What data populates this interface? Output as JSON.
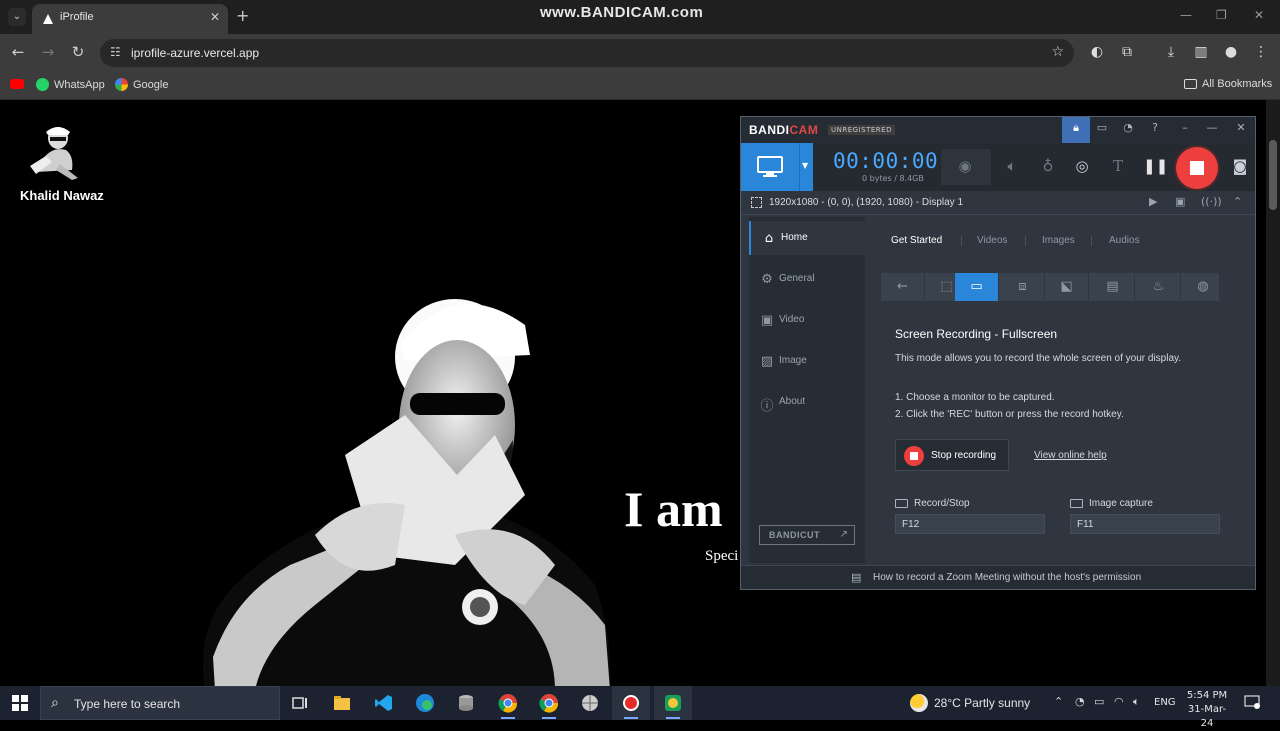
{
  "browser": {
    "tab_title": "iProfile",
    "tab_close": "✕",
    "new_tab": "+",
    "url": "iprofile-azure.vercel.app",
    "bookmarks": [
      {
        "label": "WhatsApp",
        "color": "#25d366"
      },
      {
        "label": "Google",
        "color": "#4285f4"
      }
    ],
    "all_bookmarks": "All Bookmarks"
  },
  "overlay": {
    "watermark": "www.BANDICAM.com"
  },
  "page": {
    "logo_name": "Khalid Nawaz",
    "hero_text": "I am",
    "hero_sub": "Speci"
  },
  "bandicam": {
    "logo_band": "BANDI",
    "logo_cam": "CAM",
    "unregistered": "UNREGISTERED",
    "timer": "00:00:00",
    "size": "0 bytes / 8.4GB",
    "area_info": "1920x1080 - (0, 0), (1920, 1080) - Display 1",
    "nav": [
      {
        "label": "Home",
        "icon": "home-icon"
      },
      {
        "label": "General",
        "icon": "gear-icon"
      },
      {
        "label": "Video",
        "icon": "video-icon"
      },
      {
        "label": "Image",
        "icon": "image-icon"
      },
      {
        "label": "About",
        "icon": "info-icon"
      }
    ],
    "bandicut": "BANDICUT",
    "tabs": [
      "Get Started",
      "Videos",
      "Images",
      "Audios"
    ],
    "heading": "Screen Recording - Fullscreen",
    "description": "This mode allows you to record the whole screen of your display.",
    "steps": [
      "1. Choose a monitor to be captured.",
      "2. Click the 'REC' button or press the record hotkey."
    ],
    "stop_label": "Stop recording",
    "help_link": "View online help",
    "hotkeys": [
      {
        "label": "Record/Stop",
        "key": "F12"
      },
      {
        "label": "Image capture",
        "key": "F11"
      }
    ],
    "footer": "How to record a Zoom Meeting without the host's permission",
    "colors": {
      "accent": "#2a86d9",
      "record": "#ee3f3f"
    }
  },
  "taskbar": {
    "search_placeholder": "Type here to search",
    "weather": "28°C  Partly sunny",
    "lang": "ENG",
    "time": "5:54 PM",
    "date": "31-Mar-24"
  }
}
